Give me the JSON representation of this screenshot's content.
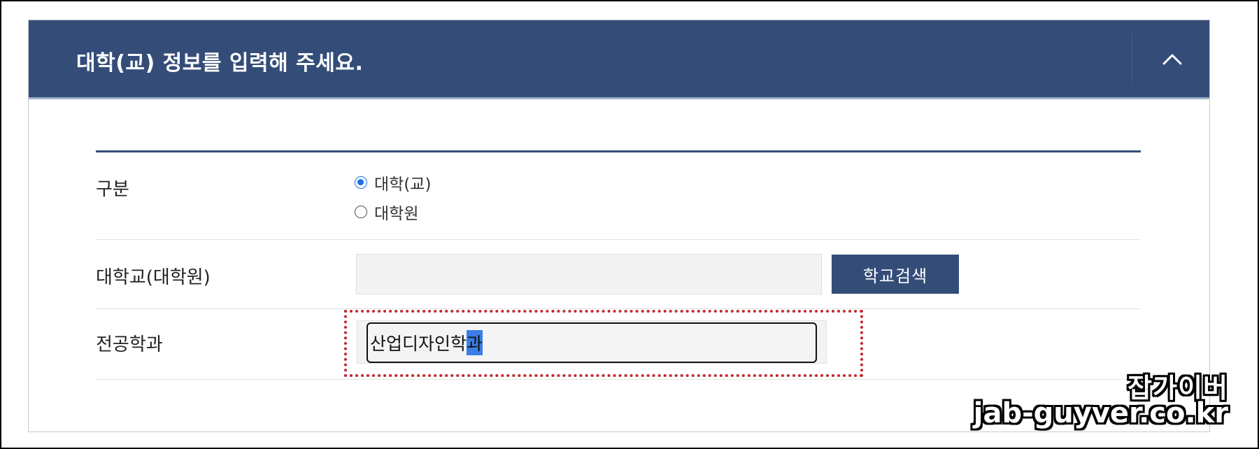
{
  "panel": {
    "title": "대학(교) 정보를 입력해 주세요.",
    "collapse_icon": "chevron-up-icon"
  },
  "form": {
    "category": {
      "label": "구분",
      "options": [
        {
          "label": "대학(교)",
          "checked": true
        },
        {
          "label": "대학원",
          "checked": false
        }
      ]
    },
    "university": {
      "label": "대학교(대학원)",
      "value": "",
      "search_button": "학교검색"
    },
    "major": {
      "label": "전공학과",
      "value_main": "산업디자인학",
      "value_selected": "과"
    }
  },
  "watermark": {
    "line1": "잡가이버",
    "line2": "jab-guyver.co.kr"
  },
  "colors": {
    "header_bg": "#344d78",
    "button_bg": "#344d78",
    "highlight": "#c0272d",
    "radio_checked": "#1a73e8"
  }
}
